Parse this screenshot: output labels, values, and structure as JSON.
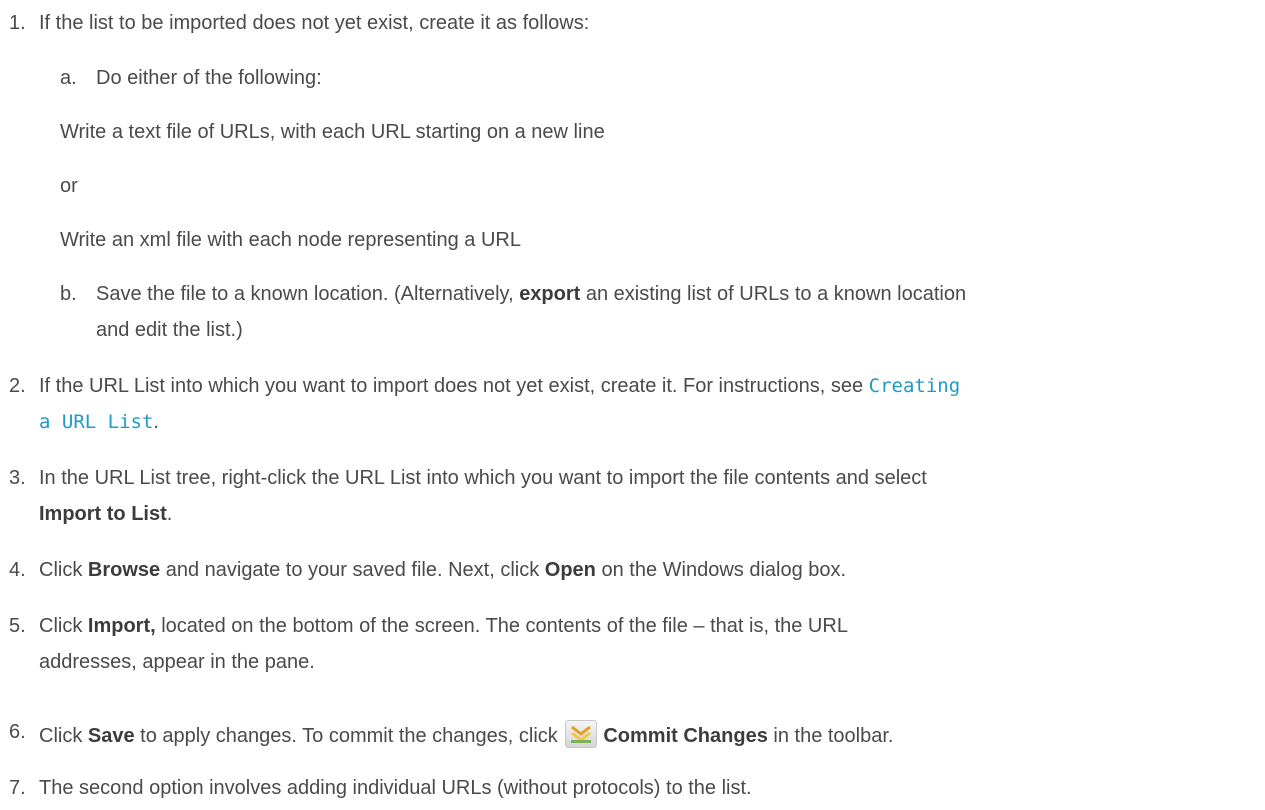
{
  "steps": [
    {
      "num": "1.",
      "text": "If the list to be imported does not yet exist, create it as follows:"
    },
    {
      "num": "2.",
      "text_a": "If the URL List into which you want to import does not yet exist, create it. For instructions, see ",
      "link_a": "Creating",
      "link_b": "a URL List",
      "text_b": "."
    },
    {
      "num": "3.",
      "text_a": "In the URL List tree, right-click the URL List into which you want to import the file contents and select",
      "bold": "Import to List",
      "text_b": "."
    },
    {
      "num": "4.",
      "text_a": "Click ",
      "bold1": "Browse",
      "text_b": " and navigate to your saved file. Next, click ",
      "bold2": "Open",
      "text_c": " on the Windows dialog box."
    },
    {
      "num": "5.",
      "text_a": "Click ",
      "bold": "Import,",
      "text_b": " located on the bottom of the screen. The contents of the file – that is, the URL",
      "text_c": "addresses, appear in the pane."
    },
    {
      "num": "6.",
      "text_a": "Click ",
      "bold1": "Save",
      "text_b": " to apply changes. To commit the changes, click ",
      "bold2": "Commit Changes",
      "text_c": " in the toolbar."
    },
    {
      "num": "7.",
      "text": "The second option involves adding individual URLs (without protocols) to the list."
    }
  ],
  "substeps": {
    "a": {
      "label": "a.",
      "text": "Do either of the following:"
    },
    "option1": "Write a text file of URLs, with each URL starting on a new line",
    "or": "or",
    "option2": "Write an xml file with each node representing a URL",
    "b": {
      "label": "b.",
      "text_a": "Save the file to a known location. (Alternatively, ",
      "bold": "export",
      "text_b": " an existing list of URLs to a known location",
      "text_c": "and edit the list.)"
    }
  },
  "icons": {
    "commit": "commit-changes-icon"
  }
}
